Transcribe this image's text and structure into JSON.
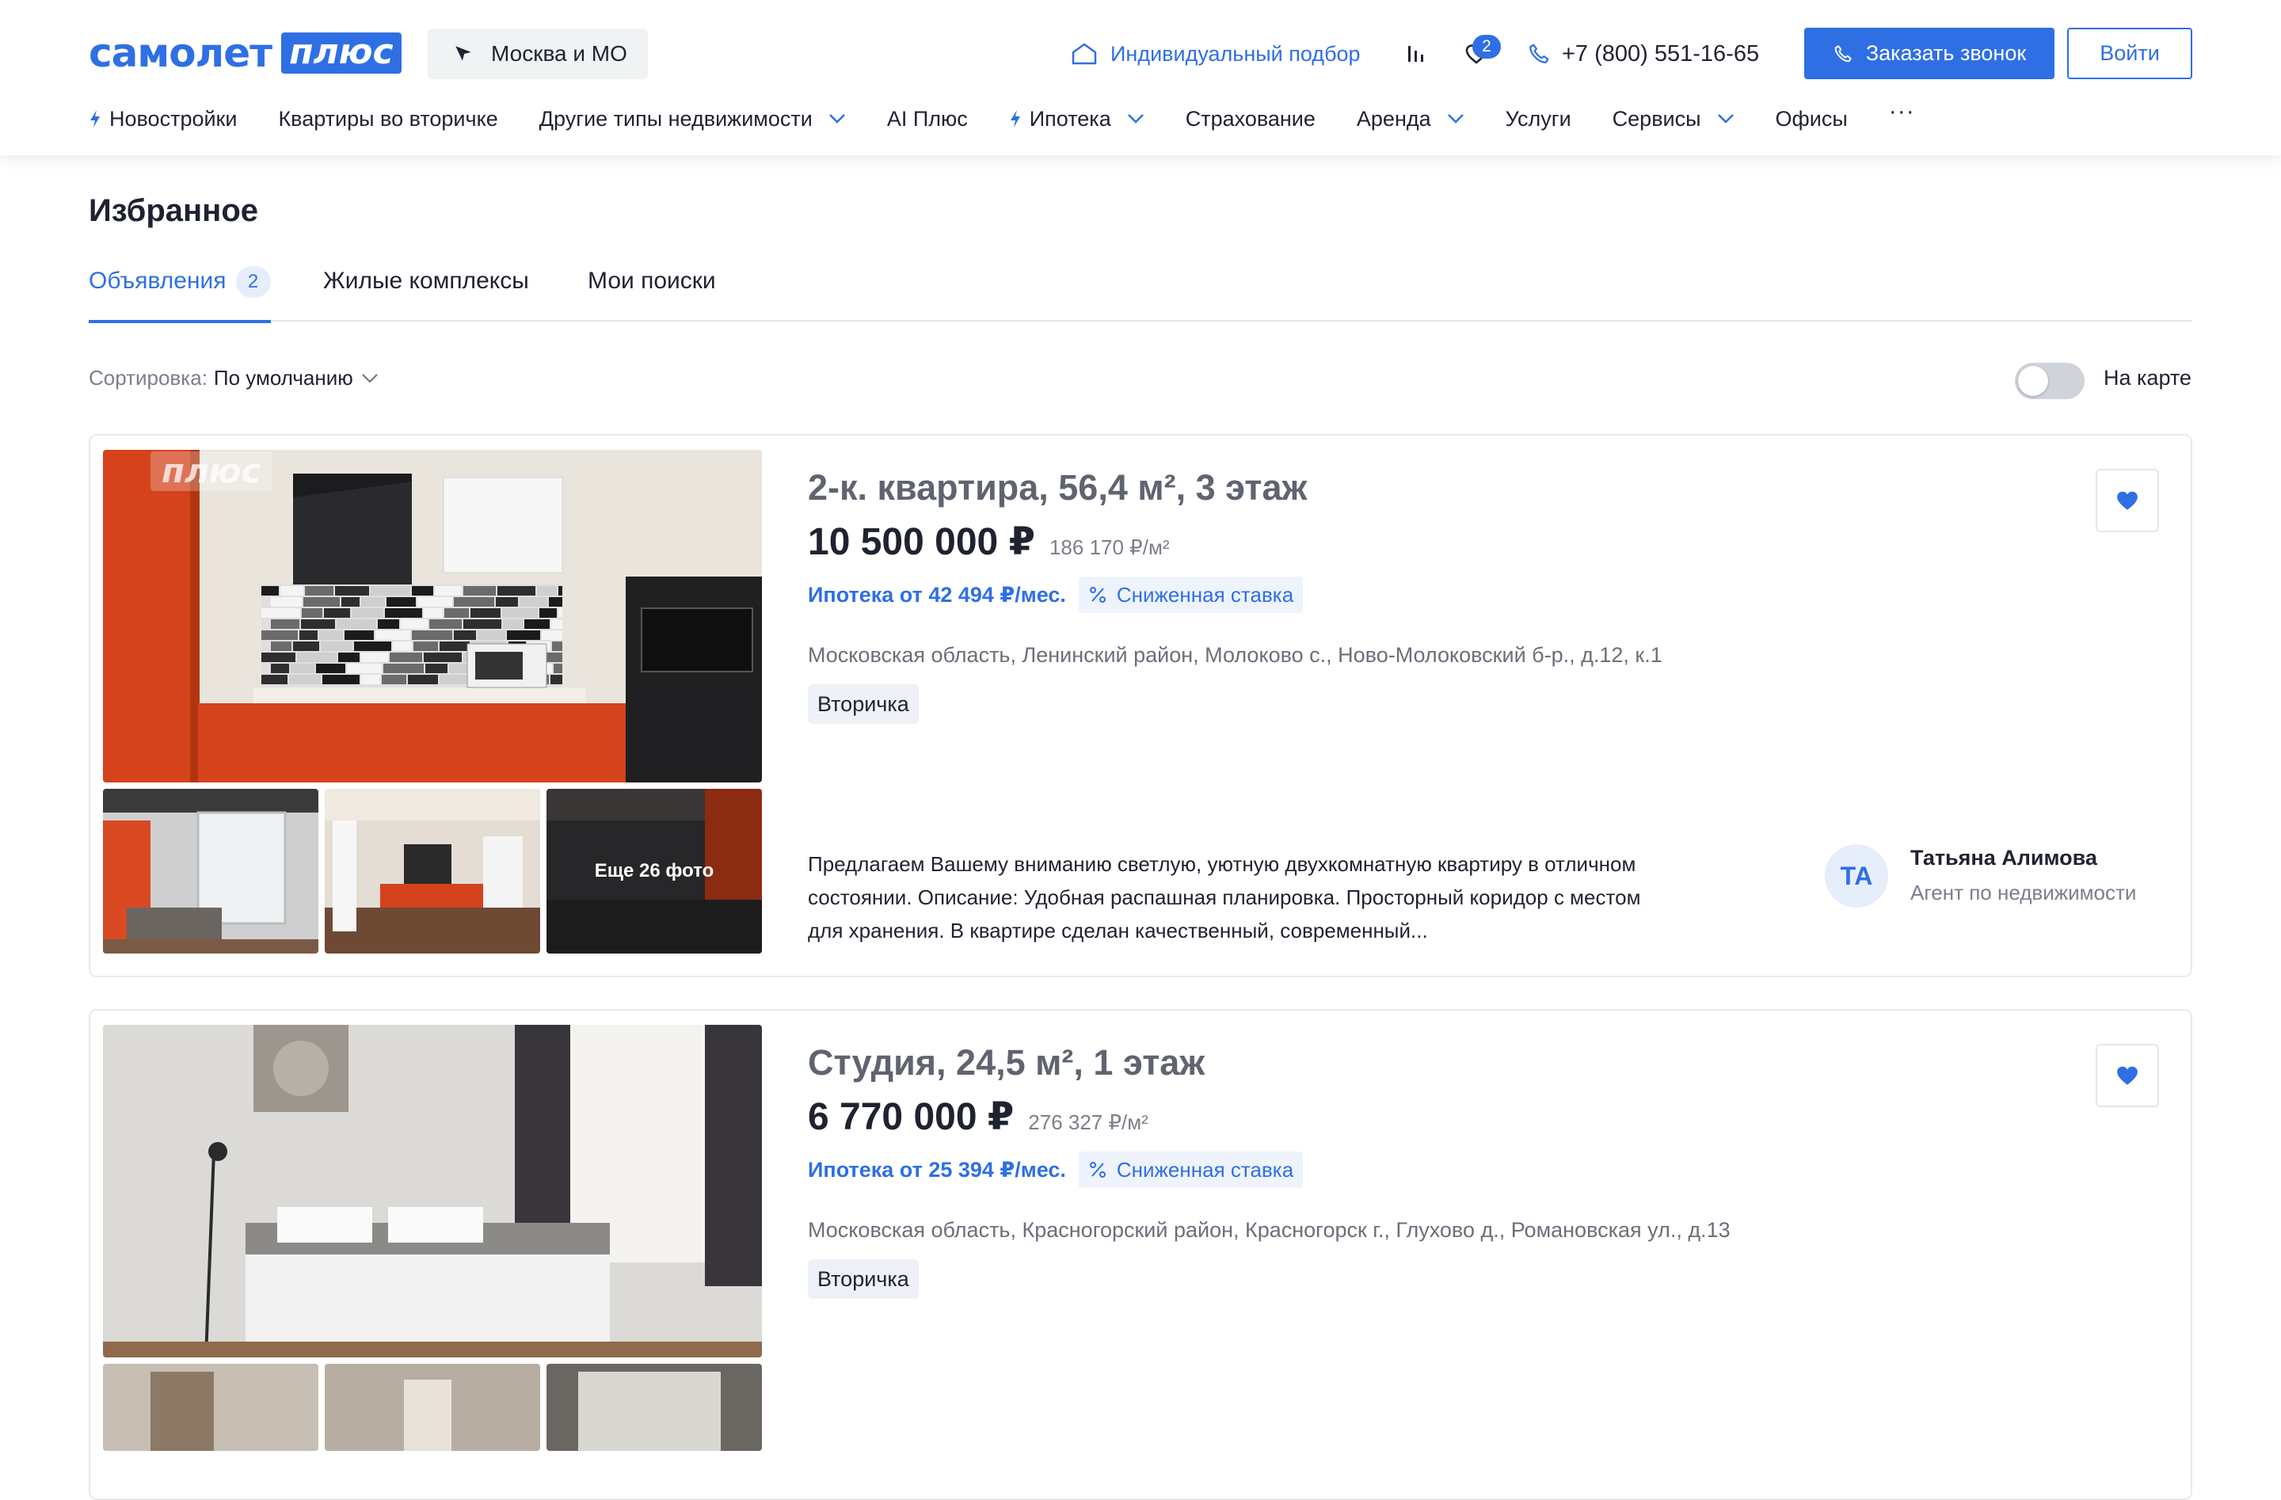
{
  "brand": {
    "name": "самолет",
    "badge": "плюс",
    "accent": "#2f6fe4"
  },
  "header": {
    "region": "Москва и МО",
    "individual_selection": "Индивидуальный подбор",
    "favorites_count": "2",
    "phone": "+7 (800) 551-16-65",
    "call_button": "Заказать звонок",
    "login_button": "Войти",
    "icons": [
      "location-arrow-icon",
      "house-icon",
      "compare-bars-icon",
      "heart-icon",
      "phone-icon"
    ]
  },
  "nav": {
    "items": [
      {
        "label": "Новостройки",
        "bolt": true,
        "dropdown": false
      },
      {
        "label": "Квартиры во вторичке",
        "bolt": false,
        "dropdown": false
      },
      {
        "label": "Другие типы недвижимости",
        "bolt": false,
        "dropdown": true
      },
      {
        "label": "AI Плюс",
        "bolt": false,
        "dropdown": false
      },
      {
        "label": "Ипотека",
        "bolt": true,
        "dropdown": true
      },
      {
        "label": "Страхование",
        "bolt": false,
        "dropdown": false
      },
      {
        "label": "Аренда",
        "bolt": false,
        "dropdown": true
      },
      {
        "label": "Услуги",
        "bolt": false,
        "dropdown": false
      },
      {
        "label": "Сервисы",
        "bolt": false,
        "dropdown": true
      },
      {
        "label": "Офисы",
        "bolt": false,
        "dropdown": false
      }
    ],
    "more": "···"
  },
  "page": {
    "title": "Избранное",
    "tabs": [
      {
        "label": "Объявления",
        "badge": "2",
        "active": true
      },
      {
        "label": "Жилые комплексы",
        "active": false
      },
      {
        "label": "Мои поиски",
        "active": false
      }
    ],
    "sort_label": "Сортировка:",
    "sort_value": "По умолчанию",
    "map_toggle_label": "На карте",
    "map_toggle_on": false
  },
  "listings": [
    {
      "title": "2-к. квартира, 56,4 м², 3 этаж",
      "price": "10 500 000 ₽",
      "price_per_sqm": "186 170 ₽/м²",
      "mortgage": "Ипотека от 42 494 ₽/мес.",
      "rate_badge": "Сниженная ставка",
      "address": "Московская область, Ленинский район, Молоково с., Ново-Молоковский б-р., д.12, к.1",
      "tag": "Вторичка",
      "photo_watermark": "плюс",
      "more_photos": "Еще 26 фото",
      "description": "Предлагаем Вашему вниманию светлую, уютную двухкомнатную квартиру в отличном состоянии. Описание: Удобная распашная планировка. Просторный коридор с местом для хранения. В квартире сделан качественный, современный...",
      "agent_initials": "ТА",
      "agent_name": "Татьяна Алимова",
      "agent_role": "Агент по недвижимости",
      "favorited": true
    },
    {
      "title": "Студия, 24,5 м², 1 этаж",
      "price": "6 770 000 ₽",
      "price_per_sqm": "276 327 ₽/м²",
      "mortgage": "Ипотека от 25 394 ₽/мес.",
      "rate_badge": "Сниженная ставка",
      "address": "Московская область, Красногорский район, Красногорск г., Глухово д., Романовская ул., д.13",
      "tag": "Вторичка",
      "favorited": true
    }
  ]
}
